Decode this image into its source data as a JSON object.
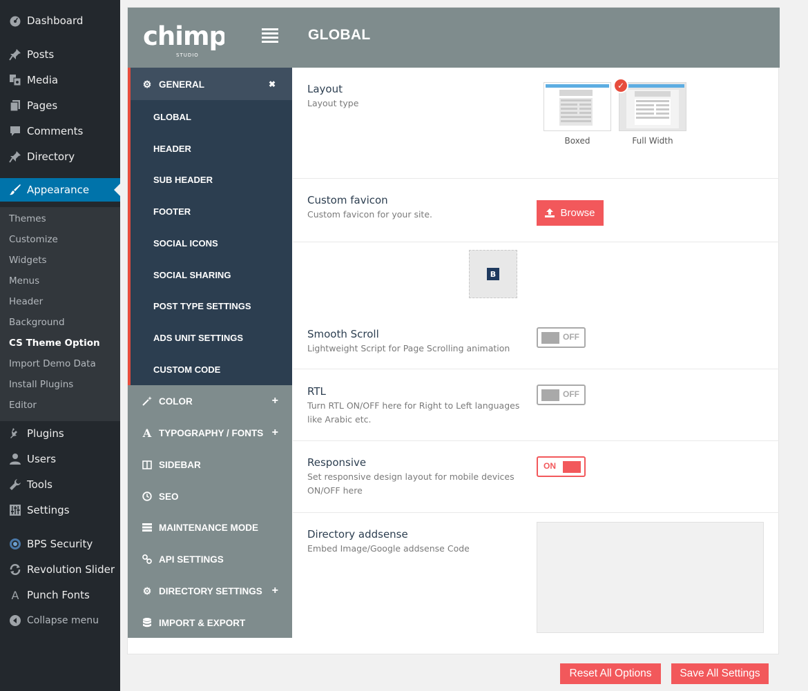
{
  "wp_menu": {
    "items": [
      {
        "label": "Dashboard",
        "icon": "dashboard-icon"
      },
      {
        "label": "Posts",
        "icon": "pin-icon"
      },
      {
        "label": "Media",
        "icon": "media-icon"
      },
      {
        "label": "Pages",
        "icon": "pages-icon"
      },
      {
        "label": "Comments",
        "icon": "comments-icon"
      },
      {
        "label": "Directory",
        "icon": "pin-icon"
      },
      {
        "label": "Appearance",
        "icon": "brush-icon"
      },
      {
        "label": "Plugins",
        "icon": "plugin-icon"
      },
      {
        "label": "Users",
        "icon": "user-icon"
      },
      {
        "label": "Tools",
        "icon": "wrench-icon"
      },
      {
        "label": "Settings",
        "icon": "sliders-icon"
      },
      {
        "label": "BPS Security",
        "icon": "shield-icon"
      },
      {
        "label": "Revolution Slider",
        "icon": "refresh-icon"
      },
      {
        "label": "Punch Fonts",
        "icon": "font-icon"
      },
      {
        "label": "Collapse menu",
        "icon": "collapse-icon"
      }
    ],
    "sub_items": [
      "Themes",
      "Customize",
      "Widgets",
      "Menus",
      "Header",
      "Background",
      "CS Theme Option",
      "Import Demo Data",
      "Install Plugins",
      "Editor"
    ],
    "active": "Appearance",
    "current_sub": "CS Theme Option"
  },
  "panel": {
    "logo": {
      "main": "chimp",
      "sub": "STUDIO"
    },
    "title": "GLOBAL"
  },
  "options_nav": {
    "general": {
      "label": "GENERAL",
      "collapse": "✖"
    },
    "general_sub": [
      "GLOBAL",
      "HEADER",
      "SUB HEADER",
      "FOOTER",
      "SOCIAL ICONS",
      "SOCIAL SHARING",
      "POST TYPE SETTINGS",
      "ADS UNIT SETTINGS",
      "CUSTOM CODE"
    ],
    "sections": [
      {
        "label": "COLOR",
        "icon": "magic-wand-icon",
        "plus": "+"
      },
      {
        "label": "TYPOGRAPHY / FONTS",
        "icon": "font-icon",
        "plus": "+"
      },
      {
        "label": "SIDEBAR",
        "icon": "columns-icon",
        "plus": ""
      },
      {
        "label": "SEO",
        "icon": "seo-icon",
        "plus": ""
      },
      {
        "label": "MAINTENANCE MODE",
        "icon": "server-icon",
        "plus": ""
      },
      {
        "label": "API SETTINGS",
        "icon": "link-icon",
        "plus": ""
      },
      {
        "label": "DIRECTORY SETTINGS",
        "icon": "gear-icon",
        "plus": "+"
      },
      {
        "label": "IMPORT & EXPORT",
        "icon": "database-icon",
        "plus": ""
      }
    ]
  },
  "content": {
    "layout": {
      "label": "Layout",
      "desc": "Layout type",
      "options": [
        "Boxed",
        "Full Width"
      ],
      "selected": "Full Width"
    },
    "favicon": {
      "label": "Custom favicon",
      "desc": "Custom favicon for your site.",
      "button": "Browse",
      "preview_letter": "B"
    },
    "smooth_scroll": {
      "label": "Smooth Scroll",
      "desc": "Lightweight Script for Page Scrolling animation",
      "state": "OFF"
    },
    "rtl": {
      "label": "RTL",
      "desc": "Turn RTL ON/OFF here for Right to Left languages like Arabic etc.",
      "state": "OFF"
    },
    "responsive": {
      "label": "Responsive",
      "desc": "Set responsive design layout for mobile devices ON/OFF here",
      "state": "ON"
    },
    "addsense": {
      "label": "Directory addsense",
      "desc": "Embed Image/Google addsense Code",
      "value": ""
    }
  },
  "footer": {
    "reset": "Reset All Options",
    "save": "Save All Settings"
  },
  "colors": {
    "accent": "#f2585b",
    "nav_dark": "#2c3e50",
    "nav_grey": "#7f8c8d",
    "wp_blue": "#0073aa"
  }
}
